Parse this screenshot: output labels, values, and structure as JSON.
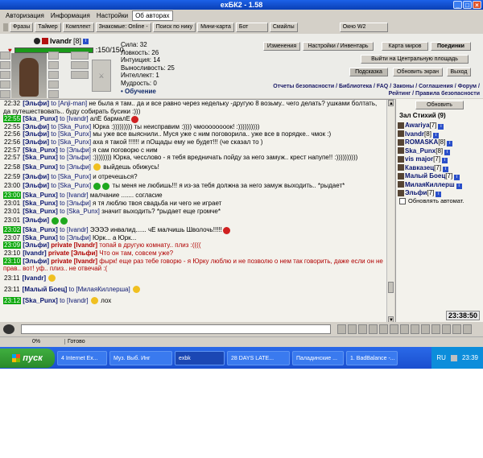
{
  "window": {
    "title": "exБК2 - 1.58"
  },
  "menu": [
    "Авторизация",
    "Информация",
    "Настройки",
    "Об авторах"
  ],
  "toolbar": [
    "Фразы",
    "Таймер",
    "Комплект",
    "Знакомые: Online -",
    "Поиск по нику",
    "Мини-карта",
    "Бот",
    "Смайлы",
    "Окно W2"
  ],
  "character": {
    "name": "Ivandr",
    "level": "[8]",
    "hp": ":150/150",
    "stats": [
      "Сила: 32",
      "Ловкость: 26",
      "Интуиция: 14",
      "Выносливость: 25",
      "Интеллект: 1",
      "Мудрость: 0"
    ],
    "education": "• Обучение"
  },
  "buttons": {
    "changes": "Изменения",
    "settings": "Настройки / Инвентарь",
    "map": "Карта миров",
    "duels": "Поединки",
    "exit_square": "Выйти на Центральную площадь",
    "hint": "Подсказка",
    "refresh_screen": "Обновить экран",
    "exit": "Выход",
    "refresh": "Обновить"
  },
  "links": {
    "line1": "Отчеты безопасности / Библиотека / FAQ / Законы / Соглашения / Форум /",
    "line2": "Рейтинг / Правила безопасности"
  },
  "chat": [
    {
      "time": "22:32",
      "nick": "[Эльфи]",
      "to": "to [Anji-man]",
      "text": "не была я там.. да и все равно через недельку -другую 8 возьму.. чего делать? ушками болтать, да путешествовать.. буду собирать бусики :)))"
    },
    {
      "time": "22:55",
      "hl": true,
      "nick": "[Ska_Punx]",
      "to": "to [Ivandr]",
      "text": "алЕ бармалЕ",
      "smile": "r"
    },
    {
      "time": "22:55",
      "nick": "[Эльфи]",
      "to": "to [Ska_Punx]",
      "text": "Юрка :))))))))) ты неисправим :)))) чмоооооооок! :))))))))))"
    },
    {
      "time": "22:56",
      "nick": "[Эльфи]",
      "to": "to [Ska_Punx]",
      "text": "мы уже все выяснили.. Муся уже с ним поговорила.. уже все в порядке.. чмок :)"
    },
    {
      "time": "22:56",
      "nick": "[Эльфи]",
      "to": "to [Ska_Punx]",
      "text": "аха я такой !!!!!! и пОщады ему не будет!!! (че сказал то )"
    },
    {
      "time": "22:57",
      "nick": "[Ska_Punx]",
      "to": "to [Эльфи]",
      "text": "я сам поговорю с ним"
    },
    {
      "time": "22:57",
      "nick": "[Ska_Punx]",
      "to": "to [Эльфи]",
      "text": ":)))))))) Юрка, чесслово - я тебя вредничать пойду за него замуж.. крест напупе!! :))))))))))"
    },
    {
      "time": "22:58",
      "big": true,
      "nick": "[Ska_Punx]",
      "to": "to [Эльфи]",
      "text": "",
      "smile": "y",
      "text2": "выйдешь обижусь!"
    },
    {
      "time": "22:59",
      "nick": "[Эльфи]",
      "to": "to [Ska_Punx]",
      "text": "и отречешься?"
    },
    {
      "time": "23:00",
      "big": true,
      "nick": "[Эльфи]",
      "to": "to [Ska_Punx]",
      "text": "",
      "smile": "g",
      "smile2": true,
      "text2": "ты меня не любишь!!! я из-за тебя должна за него замуж выходить.. *рыдает*"
    },
    {
      "time": "23:00",
      "hl": true,
      "nick": "[Ska_Punx]",
      "to": "to [Ivandr]",
      "text": "малчание ....... согласие"
    },
    {
      "time": "23:01",
      "nick": "[Ska_Punx]",
      "to": "to [Эльфи]",
      "text": "я тя люблю твоя свадьба ни чего не играет"
    },
    {
      "time": "23:01",
      "nick": "[Ska_Punx]",
      "to": "to [Ska_Punx]",
      "text": "значит выходить? *рыдает еще громче*"
    },
    {
      "time": "23:01",
      "big": true,
      "nick": "[Эльфи]",
      "to": "",
      "text": "",
      "smile": "g",
      "smile2": true,
      "text2": ""
    },
    {
      "time": "23:02",
      "hl": true,
      "nick": "[Ska_Punx]",
      "to": "to [Ivandr]",
      "text": "ЭЭЭЭ инвалид...... чЕ малчишь Шволочь!!!!!",
      "smile": "r"
    },
    {
      "time": "23:07",
      "nick": "[Ska_Punx]",
      "to": "to [Эльфи]",
      "text": "Юрк... а Юрк..."
    },
    {
      "time": "23:09",
      "hl": true,
      "nick": "[Эльфи]",
      "pv": "private [Ivandr]",
      "text": "топай в другую комнату.. плиз :(((("
    },
    {
      "time": "23:10",
      "nick": "[Ivandr]",
      "pv": "private [Эльфи]",
      "text": "Что он там, совсем уже?"
    },
    {
      "time": "23:10",
      "hl": true,
      "nick": "[Эльфи]",
      "pv": "private [Ivandr]",
      "text": "фырк! еще раз тебе говорю - я Юрку люблю и не позволю о нем так говорить, даже если он не прав.. вот! уф.. плиз.. не отвечай :("
    },
    {
      "time": "23:11",
      "big": true,
      "nick": "[Ivandr]",
      "to": "",
      "text": "",
      "smile": "y",
      "text2": ""
    },
    {
      "time": "23:11",
      "big": true,
      "nick": "[Малый Боец]",
      "to": "to [МилаяКиллерша]",
      "text": "",
      "smile": "y",
      "text2": ""
    },
    {
      "time": "23:12",
      "hl": true,
      "big": true,
      "nick": "[Ska_Punx]",
      "to": "to [Ivandr]",
      "text": "",
      "smile": "y",
      "text2": "лох"
    }
  ],
  "room": {
    "title": "Зал Стихий (9)"
  },
  "users": [
    {
      "name": "Awariya",
      "lvl": "[7]"
    },
    {
      "name": "Ivandr",
      "lvl": "[8]"
    },
    {
      "name": "ROMASKA",
      "lvl": "[8]"
    },
    {
      "name": "Ska_Punx",
      "lvl": "[8]"
    },
    {
      "name": "vis major",
      "lvl": "[7]"
    },
    {
      "name": "Кавказец",
      "lvl": "[7]"
    },
    {
      "name": "Малый Боец",
      "lvl": "[7]"
    },
    {
      "name": "МилаяКиллерш",
      "lvl": ""
    },
    {
      "name": "Эльфи",
      "lvl": "[7]"
    }
  ],
  "auto_refresh": "Обновлять автомат.",
  "clock": "23:38:50",
  "status": {
    "progress": "0%",
    "text": "Готово"
  },
  "taskbar": {
    "start": "пуск",
    "items": [
      "4 Internet Ex...",
      "Муз. Выб. Инг",
      "exbk",
      "28 DAYS LATE...",
      "Паладинские ...",
      "1. BadBalance -..."
    ],
    "lang": "RU",
    "time": "23:39"
  }
}
